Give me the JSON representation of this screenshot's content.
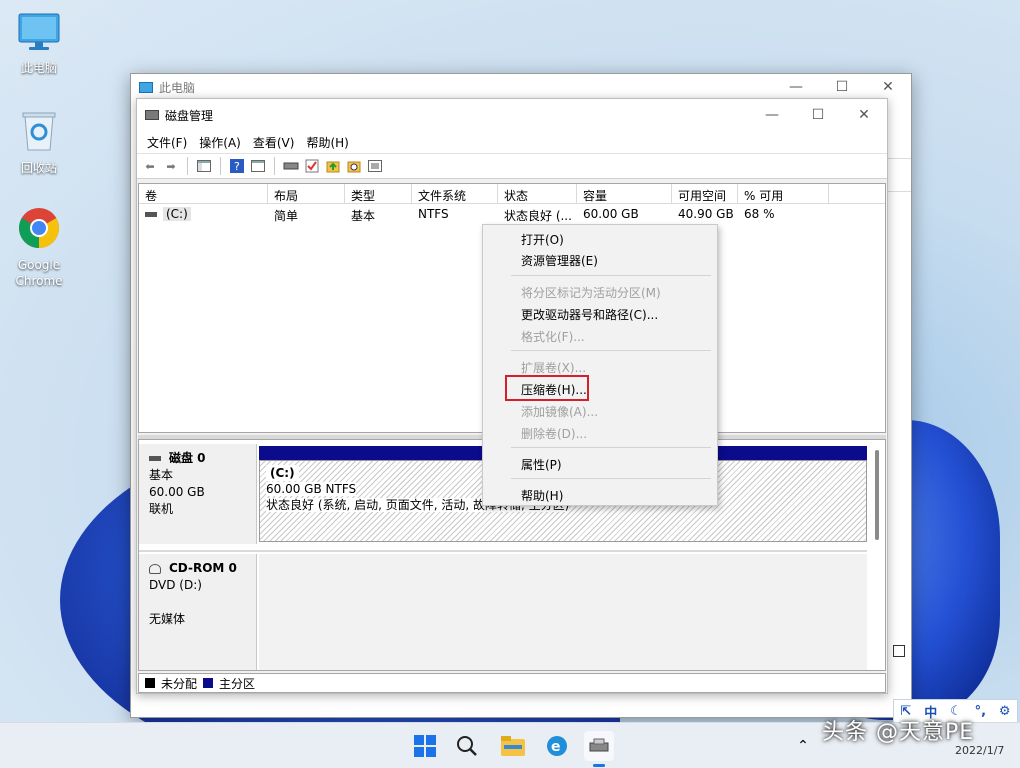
{
  "desktop": {
    "icons": [
      {
        "label": "此电脑"
      },
      {
        "label": "回收站"
      },
      {
        "label": "Google Chrome"
      }
    ]
  },
  "outer_window": {
    "title": "此电脑"
  },
  "disk_mgmt": {
    "title": "磁盘管理",
    "menu": [
      "文件(F)",
      "操作(A)",
      "查看(V)",
      "帮助(H)"
    ],
    "columns": [
      "卷",
      "布局",
      "类型",
      "文件系统",
      "状态",
      "容量",
      "可用空间",
      "% 可用"
    ],
    "rows": [
      {
        "volume": "(C:)",
        "layout": "简单",
        "type": "基本",
        "fs": "NTFS",
        "status": "状态良好 (...",
        "capacity": "60.00 GB",
        "free": "40.90 GB",
        "pct": "68 %"
      }
    ],
    "disk0": {
      "name": "磁盘 0",
      "kind": "基本",
      "size": "60.00 GB",
      "state": "联机",
      "partition": {
        "label": "(C:)",
        "size": "60.00 GB NTFS",
        "status": "状态良好 (系统, 启动, 页面文件, 活动, 故障转储, 主分区)"
      }
    },
    "cdrom0": {
      "name": "CD-ROM 0",
      "drive": "DVD (D:)",
      "media": "无媒体"
    },
    "legend": [
      {
        "label": "未分配",
        "color": "#000000"
      },
      {
        "label": "主分区",
        "color": "#0b0b8c"
      }
    ]
  },
  "context_menu": {
    "items": [
      {
        "label": "打开(O)",
        "enabled": true
      },
      {
        "label": "资源管理器(E)",
        "enabled": true
      },
      {
        "label": "将分区标记为活动分区(M)",
        "enabled": false
      },
      {
        "label": "更改驱动器号和路径(C)...",
        "enabled": true
      },
      {
        "label": "格式化(F)...",
        "enabled": false
      },
      {
        "label": "扩展卷(X)...",
        "enabled": false
      },
      {
        "label": "压缩卷(H)...",
        "enabled": true,
        "highlighted": true
      },
      {
        "label": "添加镜像(A)...",
        "enabled": false
      },
      {
        "label": "删除卷(D)...",
        "enabled": false
      },
      {
        "label": "属性(P)",
        "enabled": true
      },
      {
        "label": "帮助(H)",
        "enabled": true
      }
    ]
  },
  "tray": {
    "ime": [
      "中",
      "☾",
      "⚙"
    ],
    "date": "2022/1/7",
    "watermark": "头条 @天意PE"
  },
  "colors": {
    "primary_partition": "#0b0b8c",
    "highlight_border": "#d3202b",
    "accent": "#1a4fb8"
  }
}
